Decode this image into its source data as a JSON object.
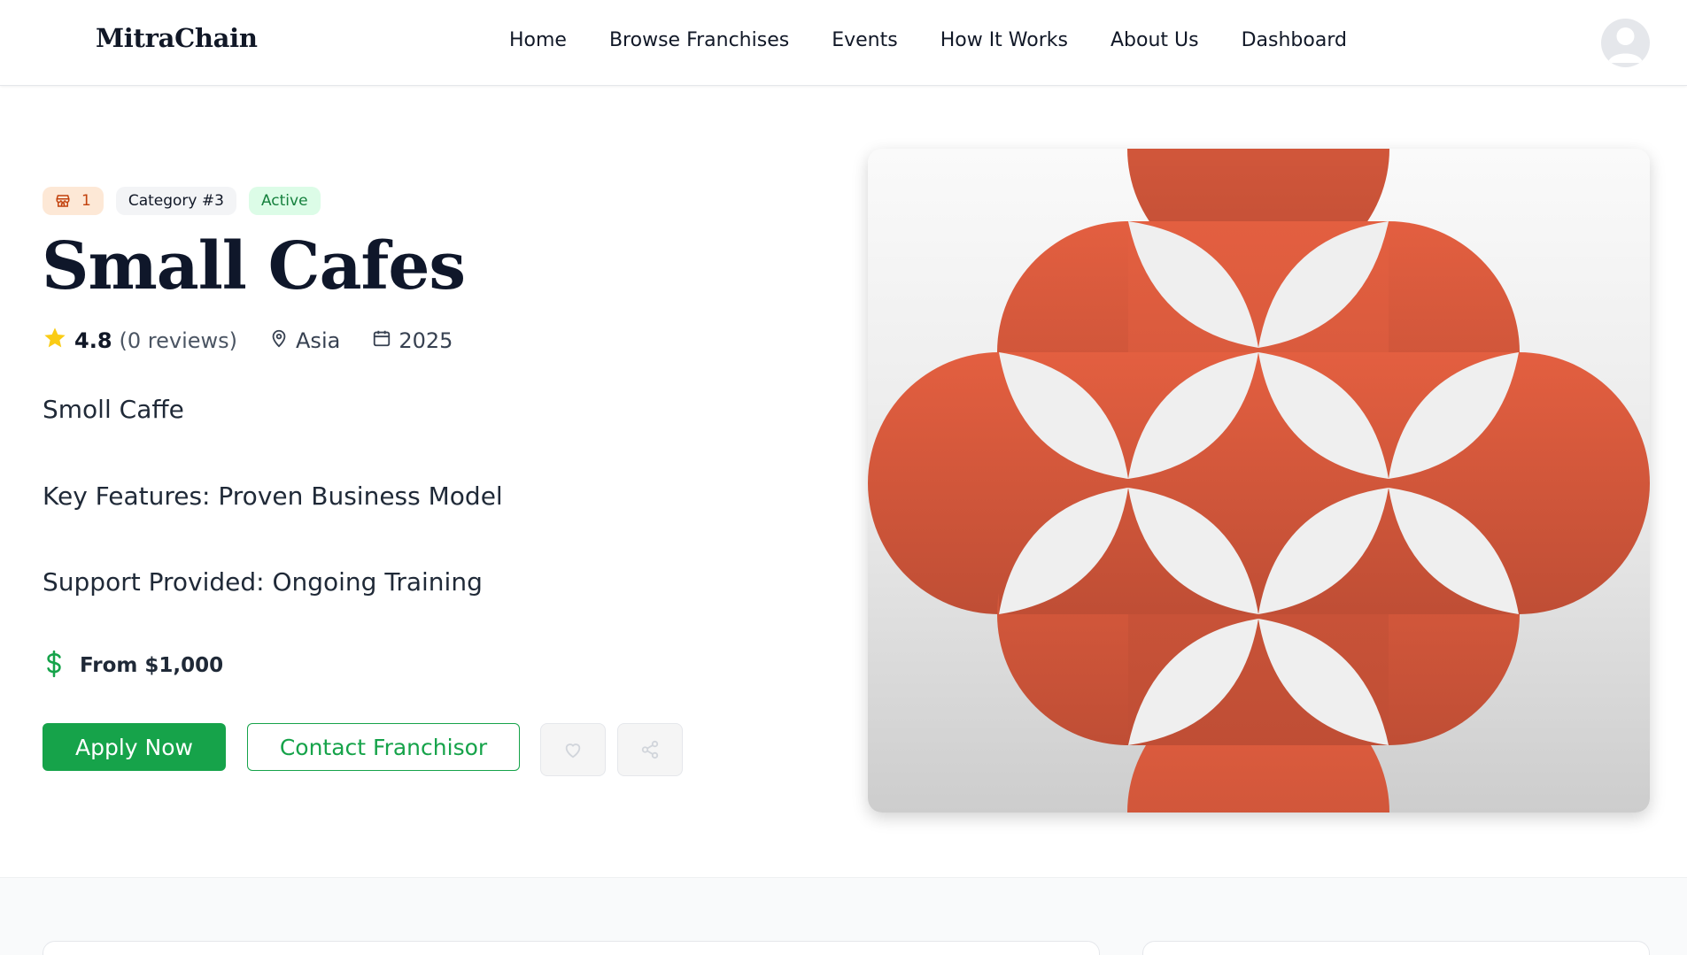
{
  "nav": {
    "brand": "MitraChain",
    "links": [
      "Home",
      "Browse Franchises",
      "Events",
      "How It Works",
      "About Us",
      "Dashboard"
    ]
  },
  "badges": {
    "store_count": "1",
    "category": "Category #3",
    "status": "Active"
  },
  "franchise": {
    "title": "Small Cafes",
    "rating": "4.8",
    "reviews": "(0 reviews)",
    "region": "Asia",
    "year": "2025",
    "description_lines": [
      "Smoll Caffe",
      "Key Features: Proven Business Model",
      "Support Provided: Ongoing Training"
    ],
    "price": "From $1,000"
  },
  "actions": {
    "apply_label": "Apply Now",
    "contact_label": "Contact Franchisor"
  },
  "colors": {
    "accent_green": "#16a34a",
    "brand_orange": "#d9573b",
    "star_yellow": "#facc15"
  }
}
